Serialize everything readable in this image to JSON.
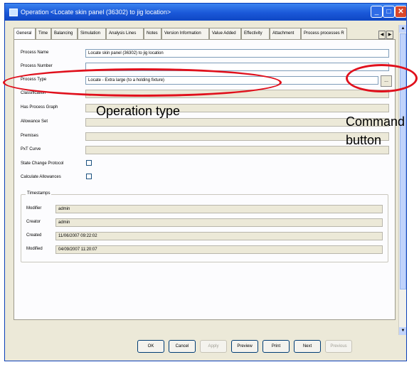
{
  "window": {
    "title": "Operation <Locate skin panel (36302) to jig location>",
    "minimize_glyph": "_",
    "maximize_glyph": "□",
    "close_glyph": "✕"
  },
  "tabs": [
    {
      "label": "General"
    },
    {
      "label": "Time"
    },
    {
      "label": "Balancing"
    },
    {
      "label": "Simulation"
    },
    {
      "label": "Analysis Lines"
    },
    {
      "label": "Notes"
    },
    {
      "label": "Version Information"
    },
    {
      "label": "Value Added"
    },
    {
      "label": "Effectivity"
    },
    {
      "label": "Attachment"
    },
    {
      "label": "Process processes R"
    }
  ],
  "tab_scroll": {
    "left": "◀",
    "right": "▶"
  },
  "form": {
    "process_name": {
      "label": "Process Name",
      "value": "Locate skin panel (36302) to jig location"
    },
    "process_number": {
      "label": "Process Number",
      "value": ""
    },
    "process_type": {
      "label": "Process Type",
      "value": "Locate - Extra large (to a holding fixture)",
      "button": "..."
    },
    "classification": {
      "label": "Classification",
      "value": ""
    },
    "has_process_graph": {
      "label": "Has Process Graph"
    },
    "allowance_set": {
      "label": "Allowance Set"
    },
    "premises": {
      "label": "Premises"
    },
    "pt_curve": {
      "label": "PxT Curve"
    },
    "state_change_protocol": {
      "label": "State Change Protocol"
    },
    "calculate_allowances": {
      "label": "Calculate Allowances"
    }
  },
  "timestamps": {
    "legend": "Timestamps",
    "rows": [
      {
        "label": "Modifier",
        "value": "admin"
      },
      {
        "label": "Creator",
        "value": "admin"
      },
      {
        "label": "Created",
        "value": "11/06/2007 09:22:02"
      },
      {
        "label": "Modified",
        "value": "04/09/2007 11:20:07"
      }
    ]
  },
  "scroll": {
    "up": "▲",
    "down": "▼"
  },
  "buttons": [
    {
      "label": "OK",
      "enabled": true
    },
    {
      "label": "Cancel",
      "enabled": true
    },
    {
      "label": "Apply",
      "enabled": false
    },
    {
      "label": "Preview",
      "enabled": true
    },
    {
      "label": "Print",
      "enabled": true
    },
    {
      "label": "Next",
      "enabled": true
    },
    {
      "label": "Previous",
      "enabled": false
    }
  ],
  "annotations": {
    "operation_type": "Operation type",
    "command_line1": "Command",
    "command_line2": "button",
    "highlight_color": "#e0101c"
  }
}
